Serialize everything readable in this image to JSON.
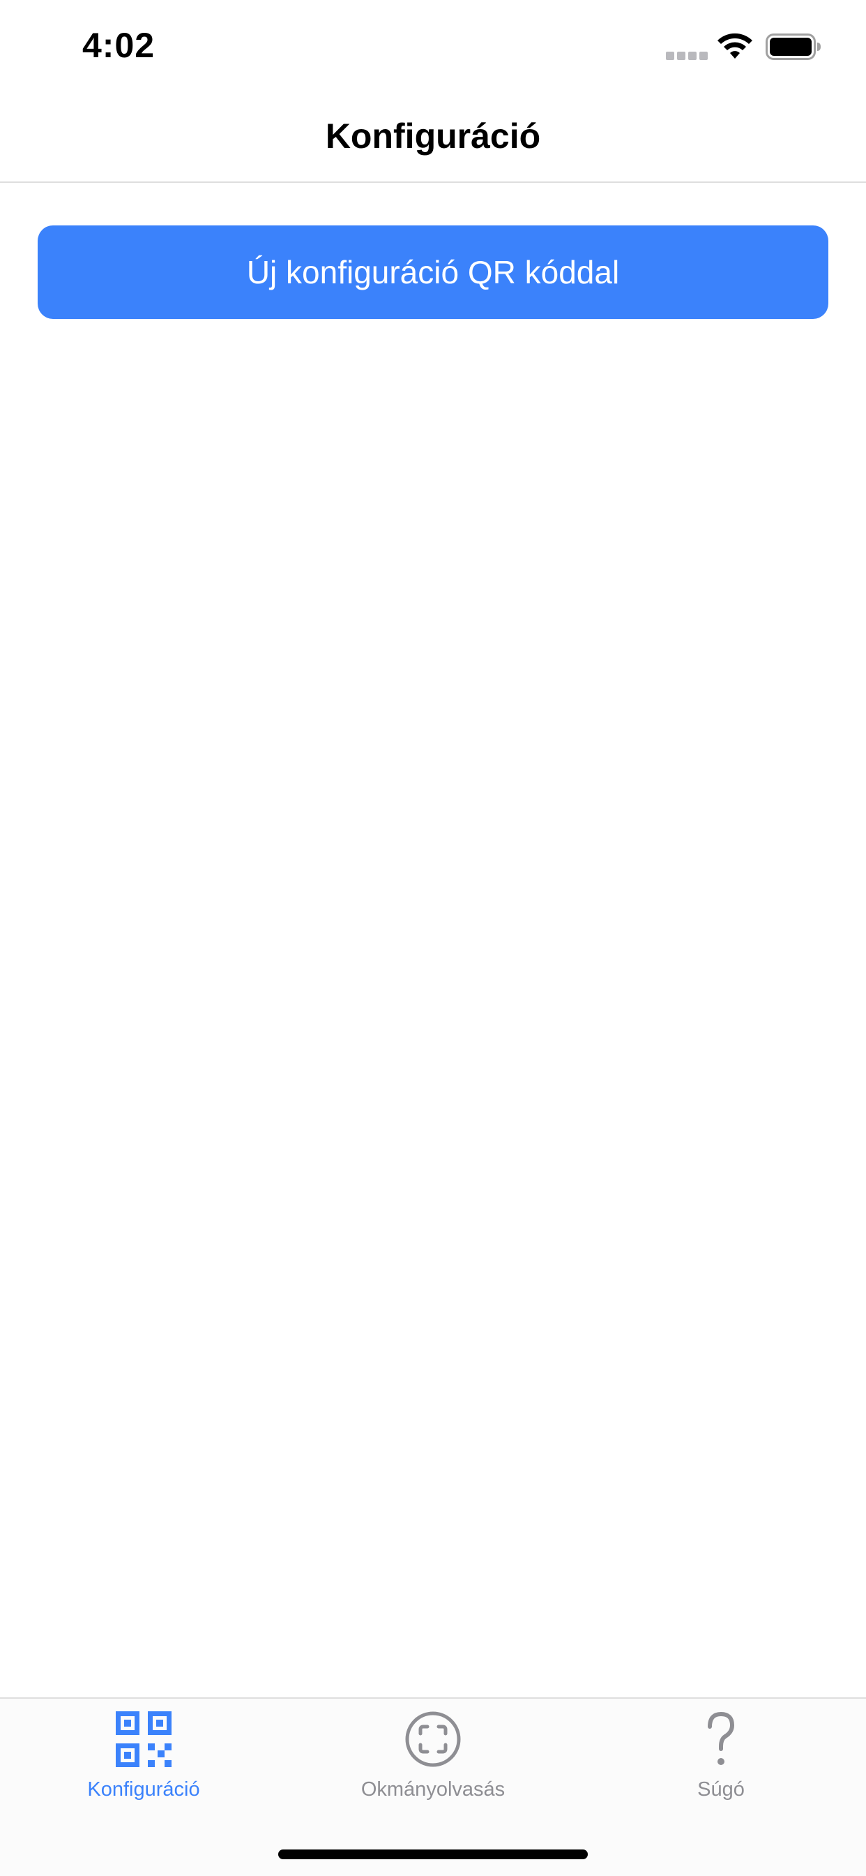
{
  "status_bar": {
    "time": "4:02"
  },
  "nav": {
    "title": "Konfiguráció"
  },
  "main": {
    "new_config_button_label": "Új konfiguráció QR kóddal"
  },
  "tab_bar": {
    "tabs": [
      {
        "label": "Konfiguráció",
        "icon": "qr-code-icon",
        "active": true
      },
      {
        "label": "Okmányolvasás",
        "icon": "face-scan-icon",
        "active": false
      },
      {
        "label": "Súgó",
        "icon": "question-mark-icon",
        "active": false
      }
    ]
  },
  "colors": {
    "accent": "#3b82fb",
    "inactive": "#8e8e93",
    "divider": "#dedede"
  }
}
